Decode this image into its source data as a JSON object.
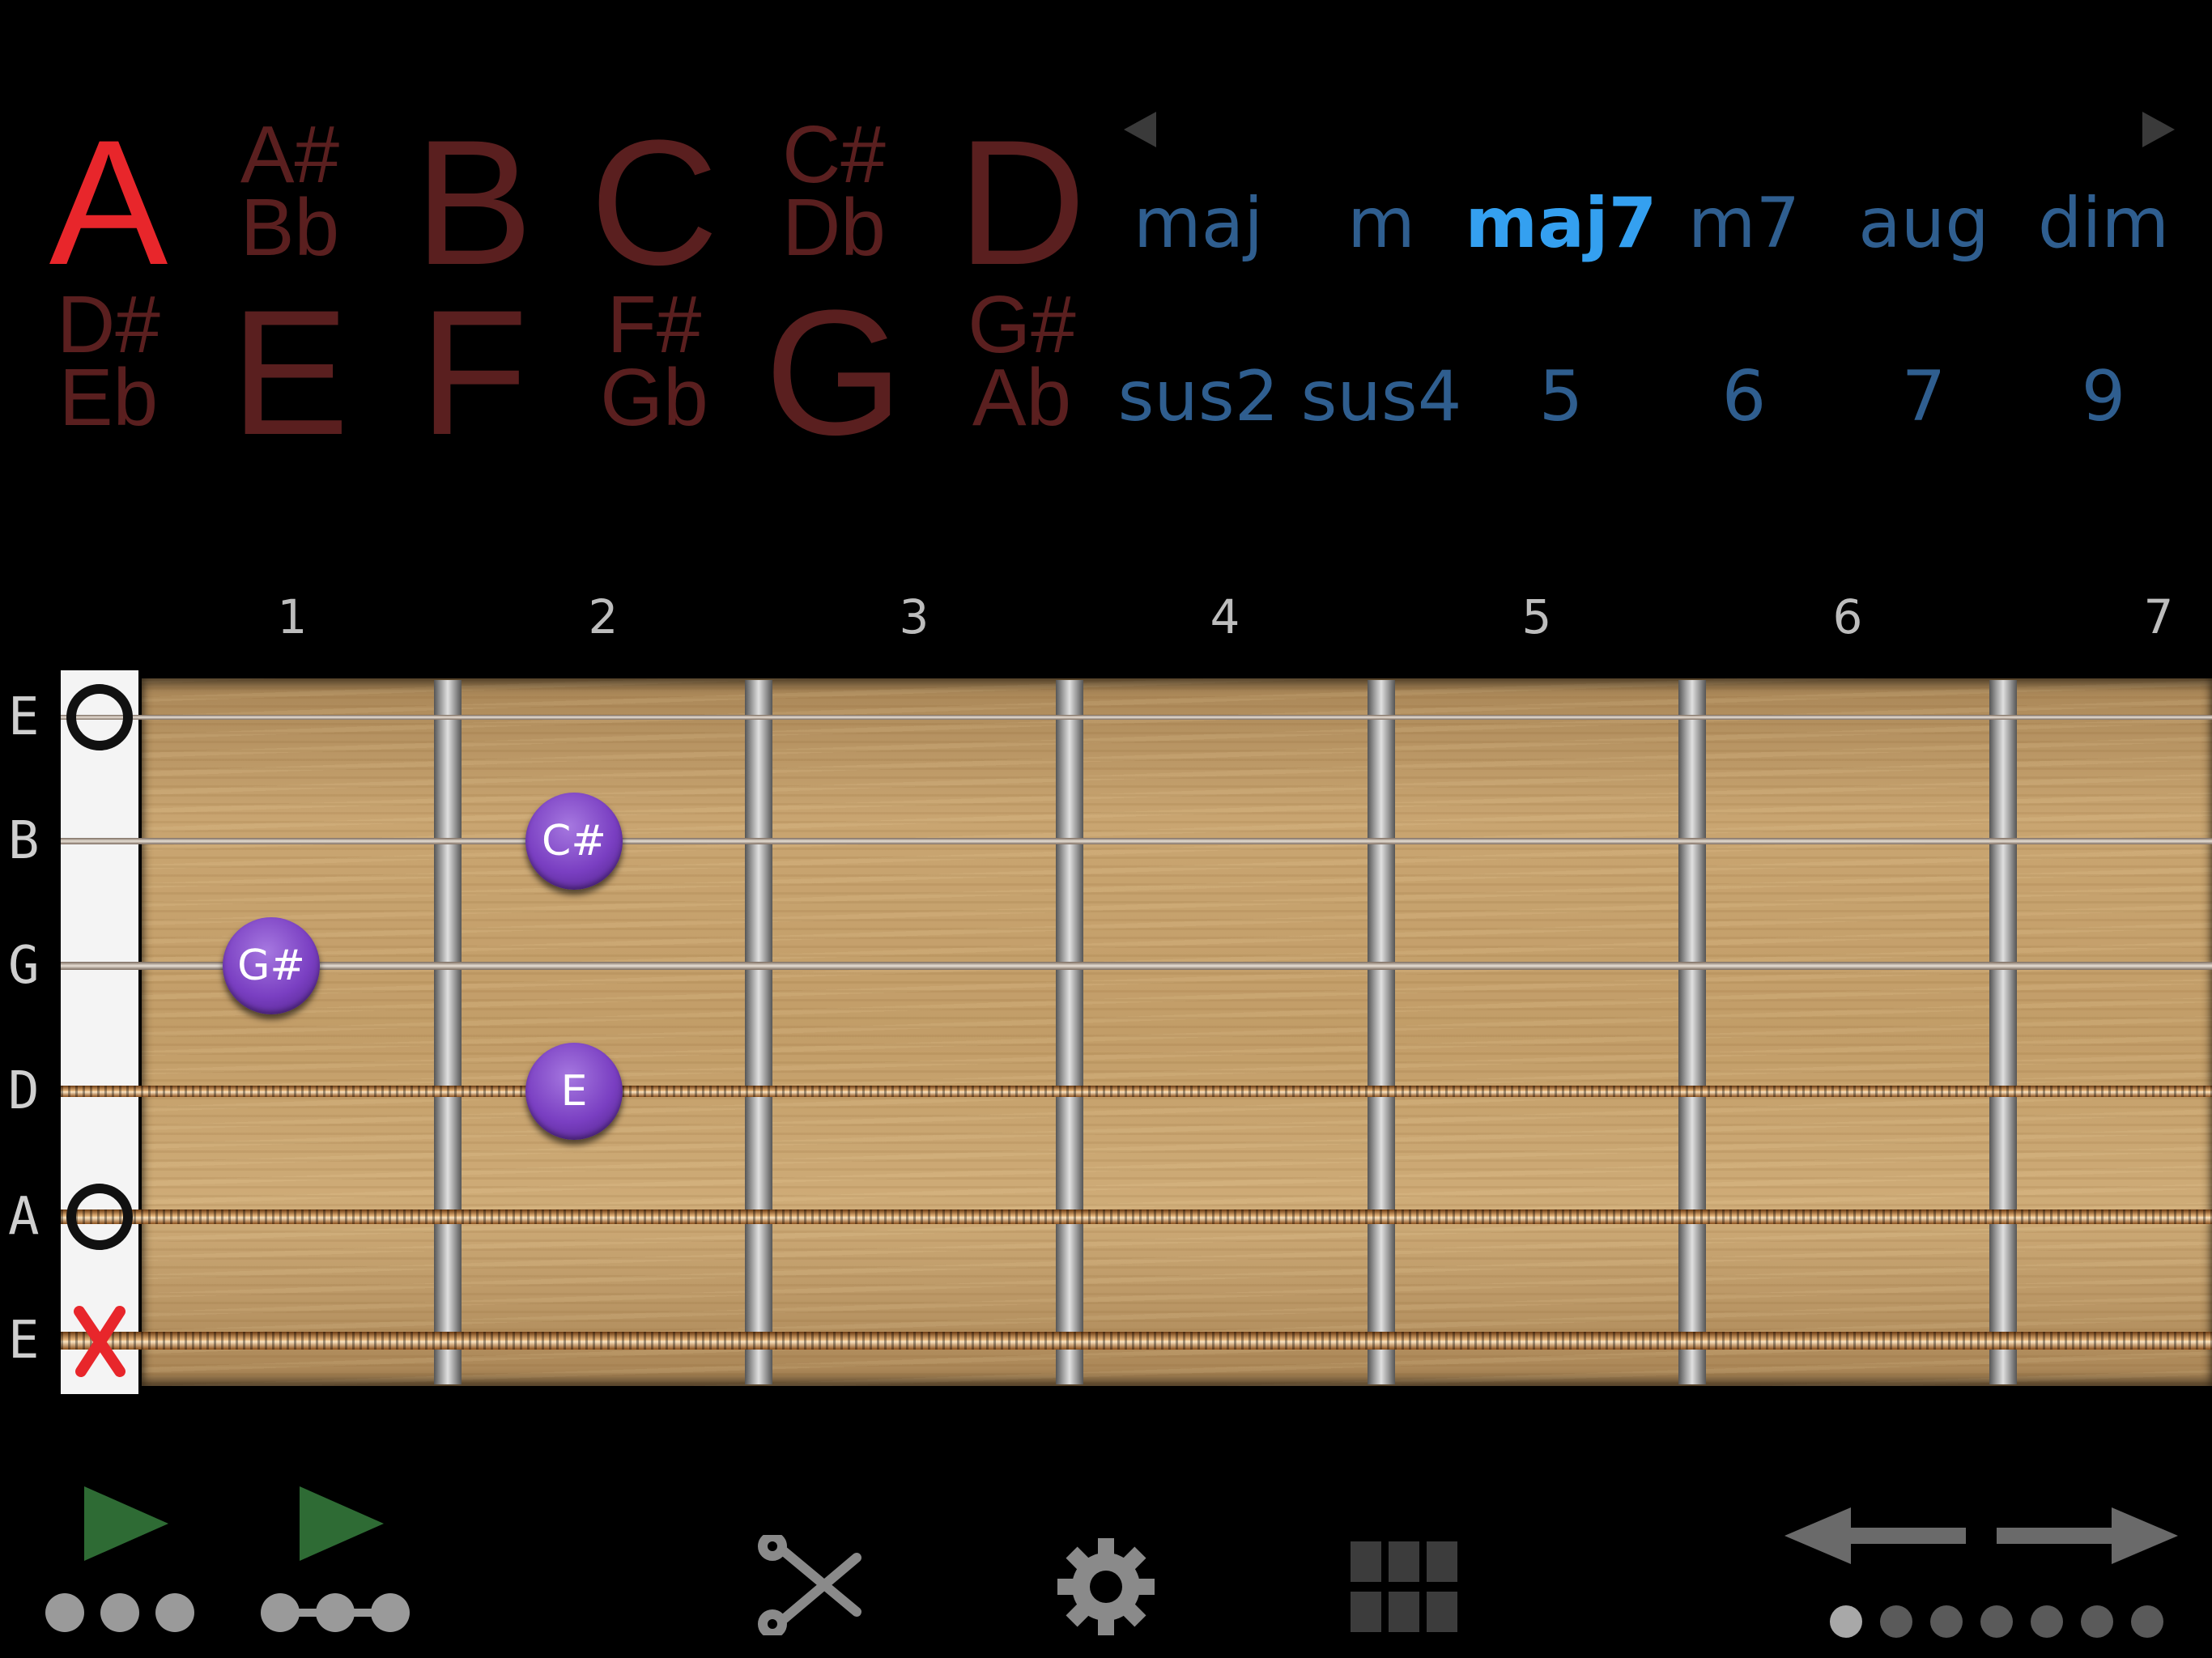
{
  "roots": {
    "selected": "A",
    "row1": [
      {
        "lines": [
          "A"
        ]
      },
      {
        "lines": [
          "A#",
          "Bb"
        ]
      },
      {
        "lines": [
          "B"
        ]
      },
      {
        "lines": [
          "C"
        ]
      },
      {
        "lines": [
          "C#",
          "Db"
        ]
      },
      {
        "lines": [
          "D"
        ]
      }
    ],
    "row2": [
      {
        "lines": [
          "D#",
          "Eb"
        ]
      },
      {
        "lines": [
          "E"
        ]
      },
      {
        "lines": [
          "F"
        ]
      },
      {
        "lines": [
          "F#",
          "Gb"
        ]
      },
      {
        "lines": [
          "G"
        ]
      },
      {
        "lines": [
          "G#",
          "Ab"
        ]
      }
    ]
  },
  "chord_types": {
    "selected": "maj7",
    "row1": [
      "maj",
      "m",
      "maj7",
      "m7",
      "aug",
      "dim"
    ],
    "row2": [
      "sus2",
      "sus4",
      "5",
      "6",
      "7",
      "9"
    ]
  },
  "fret_numbers": [
    "1",
    "2",
    "3",
    "4",
    "5",
    "6",
    "7"
  ],
  "string_labels": [
    "E",
    "B",
    "G",
    "D",
    "A",
    "E"
  ],
  "markers": [
    {
      "note": "C#",
      "string": 1,
      "fret": 2
    },
    {
      "note": "G#",
      "string": 2,
      "fret": 1
    },
    {
      "note": "E",
      "string": 3,
      "fret": 2
    }
  ],
  "open_strings": [
    0,
    4
  ],
  "muted_strings": [
    5
  ],
  "toolbar": {
    "play_chord_label": "play",
    "play_arpeggio_label": "play arpeggio",
    "page_count": 7,
    "current_page": 1
  },
  "colors": {
    "root_selected": "#e8262b",
    "root_normal": "#5a1f1f",
    "type_selected": "#34a0f0",
    "type_normal": "#2f5e8f",
    "finger": "#7a3fc2",
    "play": "#2e6b34"
  }
}
